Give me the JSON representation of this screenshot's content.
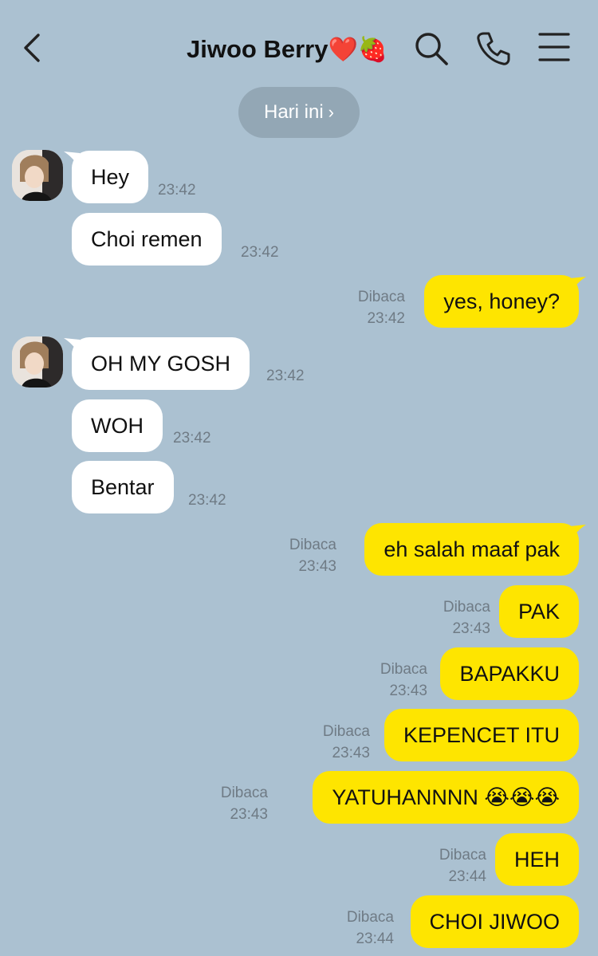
{
  "header": {
    "back_icon": "chevron-left-icon",
    "title": "Jiwoo Berry",
    "title_emoji": "❤️🍓",
    "icons": [
      "search-icon",
      "phone-icon",
      "menu-icon"
    ]
  },
  "date_pill": {
    "label": "Hari ini",
    "chevron": "›"
  },
  "colors": {
    "background": "#abc1d1",
    "incoming": "#ffffff",
    "outgoing": "#fee500",
    "meta": "#6f7b85"
  },
  "messages": [
    {
      "dir": "in",
      "text": "Hey",
      "time": "23:42"
    },
    {
      "dir": "in",
      "text": "Choi remen",
      "time": "23:42"
    },
    {
      "dir": "out",
      "text": "yes, honey?",
      "status": "Dibaca",
      "time": "23:42"
    },
    {
      "dir": "in",
      "text": "OH MY GOSH",
      "time": "23:42"
    },
    {
      "dir": "in",
      "text": "WOH",
      "time": "23:42"
    },
    {
      "dir": "in",
      "text": "Bentar",
      "time": "23:42"
    },
    {
      "dir": "out",
      "text": "eh salah maaf pak",
      "status": "Dibaca",
      "time": "23:43"
    },
    {
      "dir": "out",
      "text": "PAK",
      "status": "Dibaca",
      "time": "23:43"
    },
    {
      "dir": "out",
      "text": "BAPAKKU",
      "status": "Dibaca",
      "time": "23:43"
    },
    {
      "dir": "out",
      "text": "KEPENCET ITU",
      "status": "Dibaca",
      "time": "23:43"
    },
    {
      "dir": "out",
      "text": "YATUHANNNN 😭😭😭",
      "status": "Dibaca",
      "time": "23:43"
    },
    {
      "dir": "out",
      "text": "HEH",
      "status": "Dibaca",
      "time": "23:44"
    },
    {
      "dir": "out",
      "text": "CHOI JIWOO",
      "status": "Dibaca",
      "time": "23:44"
    }
  ]
}
